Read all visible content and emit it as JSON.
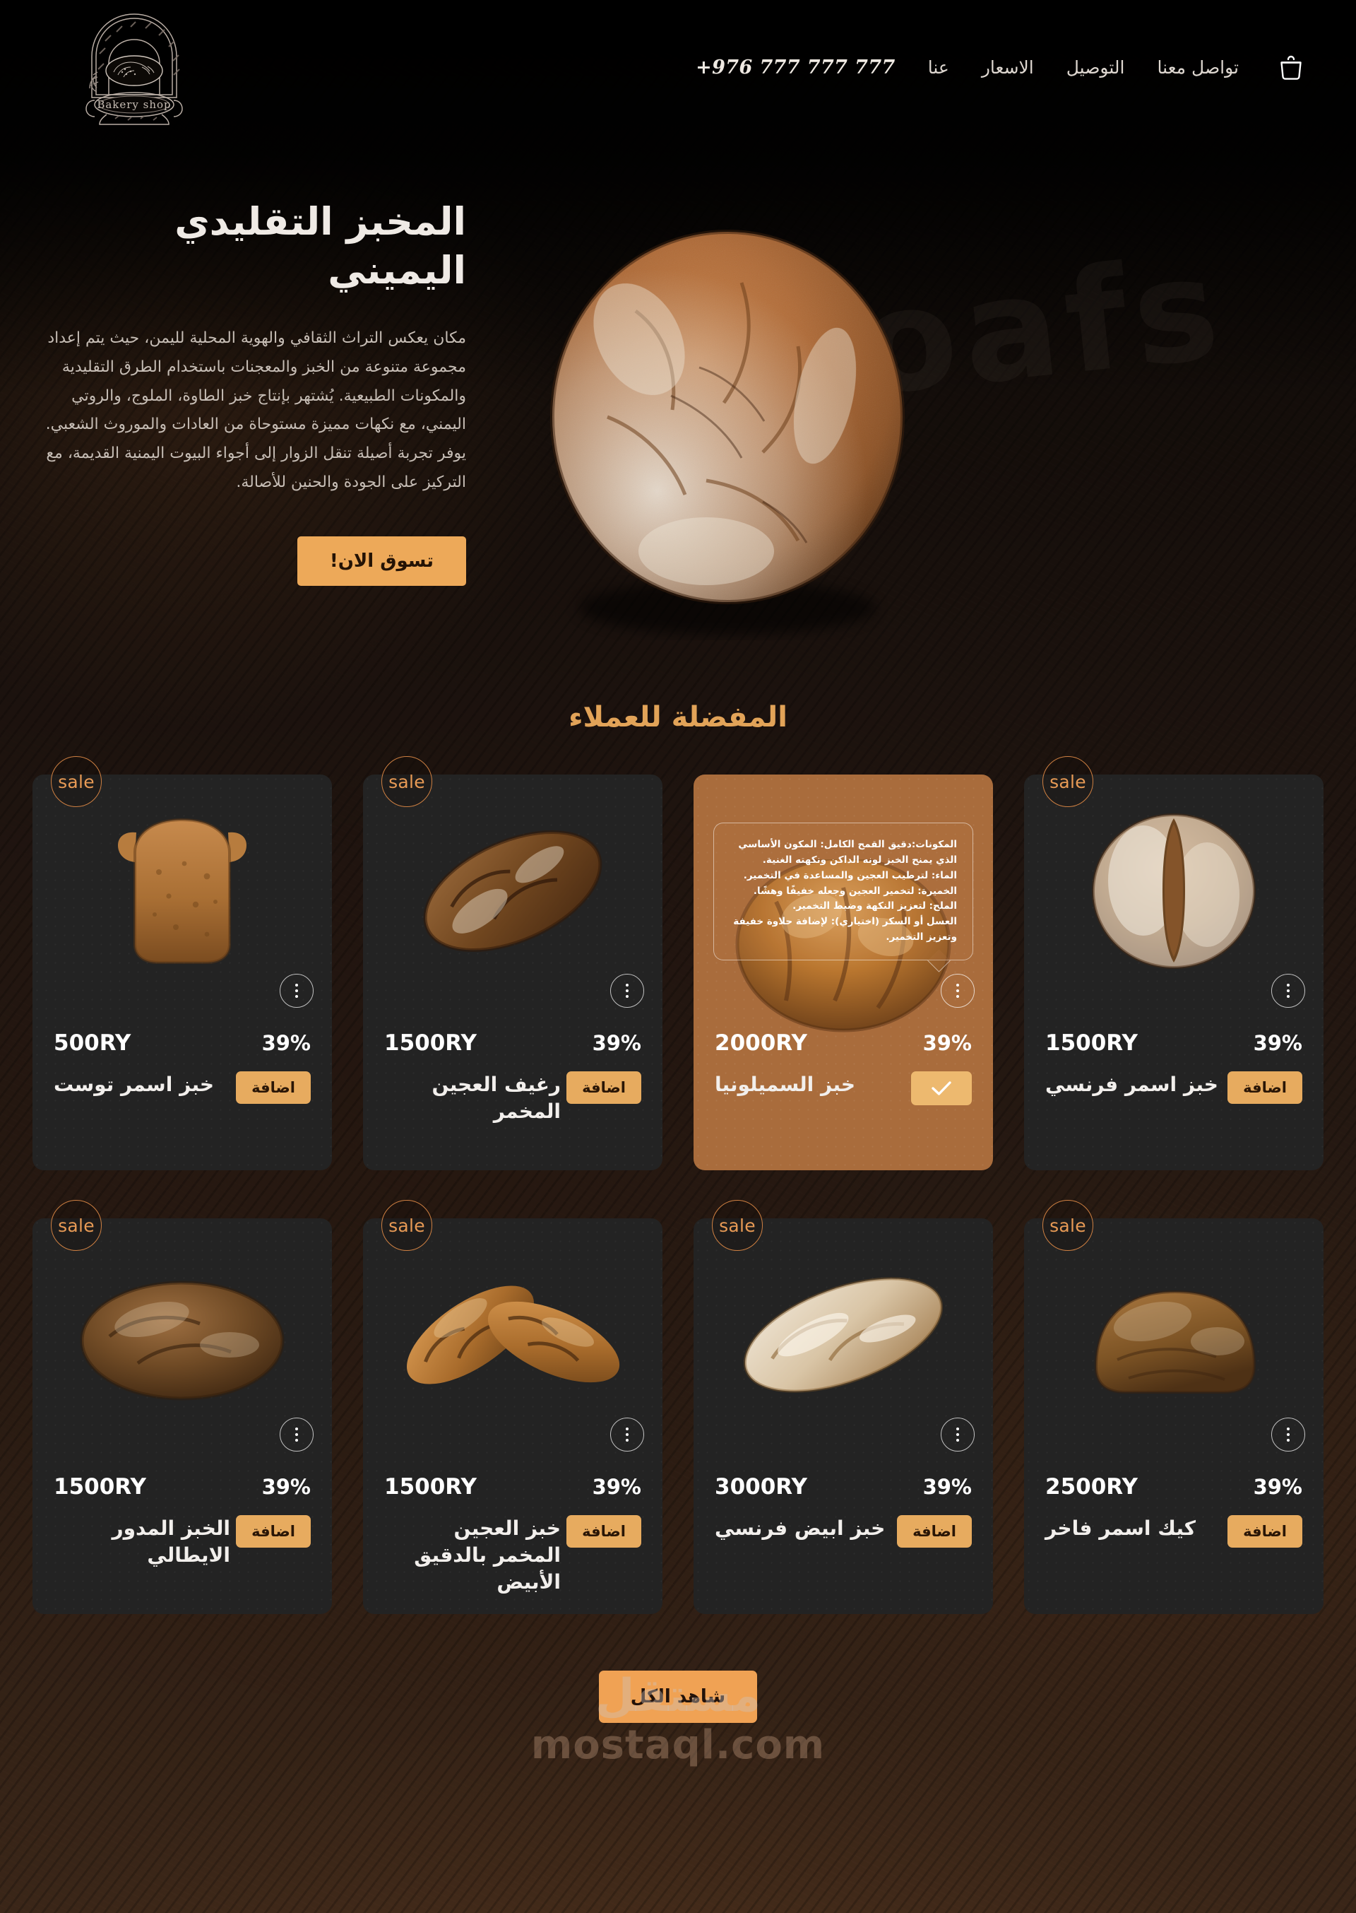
{
  "header": {
    "cart_icon": "shopping-bag-icon",
    "logo": {
      "brand_text": "Bakery shop",
      "alt": "bakery-oven-emblem"
    },
    "phone": "+976 777 777 777",
    "links": [
      {
        "label": "عنا"
      },
      {
        "label": "الاسعار"
      },
      {
        "label": "التوصيل"
      },
      {
        "label": "تواصل معنا"
      }
    ]
  },
  "hero": {
    "title": "المخبز التقليدي اليميني",
    "description": "مكان يعكس التراث الثقافي والهوية المحلية لليمن، حيث يتم إعداد مجموعة متنوعة من الخبز والمعجنات باستخدام الطرق التقليدية والمكونات الطبيعية. يُشتهر بإنتاج خبز الطاوة، الملوج، والروتي اليمني، مع نكهات مميزة مستوحاة من العادات والموروث الشعبي. يوفر تجربة أصيلة تنقل الزوار إلى أجواء البيوت اليمنية القديمة، مع التركيز على الجودة والحنين للأصالة.",
    "cta_label": "تسوق الان!",
    "watermark": "loafs"
  },
  "section": {
    "title": "المفضلة للعملاء"
  },
  "labels": {
    "sale_badge": "sale",
    "add_button": "اضافة",
    "added_icon": "check-icon",
    "more_icon": "vertical-dots-icon"
  },
  "products": [
    {
      "name": "خبز اسمر فرنسي",
      "price": "1500RY",
      "discount": "39%",
      "badge": "sale",
      "add_label": "اضافة",
      "state": "default",
      "image": "round-dusted-sourdough-loaf"
    },
    {
      "name": "خبز السميلونيا",
      "price": "2000RY",
      "discount": "39%",
      "badge": "sale",
      "add_label": "",
      "state": "added",
      "image": "golden-semolina-loaf",
      "tooltip": [
        "المكونات:دقيق القمح الكامل: المكون الأساسي الذي يمنح الخبز لونه الداكن ونكهته الغنية.",
        "الماء: لترطيب العجين والمساعدة في التخمير.",
        "الخميرة: لتخمير العجين وجعله خفيفًا وهشًا.",
        "الملح: لتعزيز النكهة وضبط التخمير.",
        "العسل أو السكر (اختياري): لإضافة حلاوة خفيفة وتعزيز التخمير."
      ]
    },
    {
      "name": "رغيف العجين المخمر",
      "price": "1500RY",
      "discount": "39%",
      "badge": "sale",
      "add_label": "اضافة",
      "state": "default",
      "image": "oval-scored-sourdough-loaf"
    },
    {
      "name": "خبز اسمر توست",
      "price": "500RY",
      "discount": "39%",
      "badge": "sale",
      "add_label": "اضافة",
      "state": "default",
      "image": "brown-toast-slice"
    },
    {
      "name": "كيك اسمر فاخر",
      "price": "2500RY",
      "discount": "39%",
      "badge": "sale",
      "add_label": "اضافة",
      "state": "default",
      "image": "brown-loaf-cake"
    },
    {
      "name": "خبز ابيض فرنسي",
      "price": "3000RY",
      "discount": "39%",
      "badge": "sale",
      "add_label": "اضافة",
      "state": "default",
      "image": "white-french-batard"
    },
    {
      "name": "خبز العجين المخمر بالدقيق الأبيض",
      "price": "1500RY",
      "discount": "39%",
      "badge": "sale",
      "add_label": "اضافة",
      "state": "default",
      "image": "twin-scored-baguettes"
    },
    {
      "name": "الخبز المدور الايطالي",
      "price": "1500RY",
      "discount": "39%",
      "badge": "sale",
      "add_label": "اضافة",
      "state": "default",
      "image": "round-italian-loaf"
    }
  ],
  "footer": {
    "view_all_label": "شاهد الكل",
    "watermark_ar": "مستقل",
    "watermark_en": "mostaql.com"
  },
  "colors": {
    "accent": "#e7ab5f",
    "cta": "#eda959",
    "section_title": "#e2a358",
    "card_bg": "#232323",
    "active_card_bg": "#a96c3c",
    "page_bg": "#17100c"
  }
}
